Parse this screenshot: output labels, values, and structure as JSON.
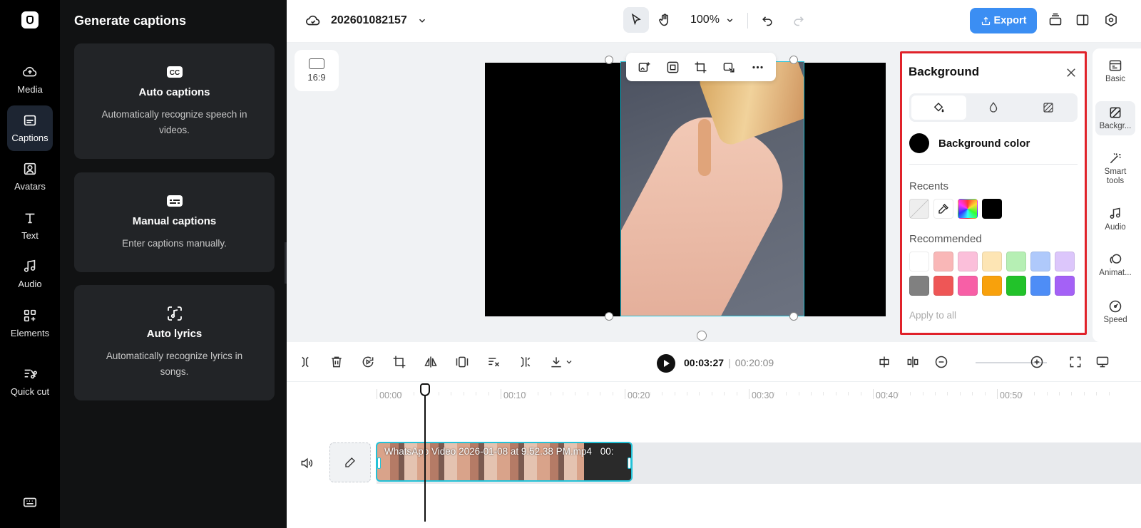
{
  "left_rail": {
    "items": [
      {
        "label": "Media",
        "icon": "cloud-upload-icon"
      },
      {
        "label": "Captions",
        "icon": "captions-icon",
        "active": true
      },
      {
        "label": "Avatars",
        "icon": "avatar-icon"
      },
      {
        "label": "Text",
        "icon": "text-icon"
      },
      {
        "label": "Audio",
        "icon": "music-note-icon"
      },
      {
        "label": "Elements",
        "icon": "elements-icon"
      },
      {
        "label": "Quick cut",
        "icon": "quick-cut-icon"
      }
    ]
  },
  "captions_panel": {
    "title": "Generate captions",
    "cards": [
      {
        "title": "Auto captions",
        "desc": "Automatically recognize speech in videos.",
        "icon": "cc-icon"
      },
      {
        "title": "Manual captions",
        "desc": "Enter captions manually.",
        "icon": "subtitle-icon"
      },
      {
        "title": "Auto lyrics",
        "desc": "Automatically recognize lyrics in songs.",
        "icon": "music-scan-icon"
      }
    ]
  },
  "topbar": {
    "project_name": "202601082157",
    "zoom": "100%",
    "export_label": "Export"
  },
  "canvas": {
    "aspect_ratio": "16:9"
  },
  "background_panel": {
    "title": "Background",
    "bg_color_label": "Background color",
    "bg_color": "#000000",
    "recents_label": "Recents",
    "recommended_label": "Recommended",
    "apply_all": "Apply to all",
    "recents": [
      "none",
      "eyedropper",
      "rainbow",
      "#000000"
    ],
    "recommended_row1": [
      "#ffffff",
      "#f9b7b7",
      "#fbbfda",
      "#fde5b4",
      "#b6efb4",
      "#afc9fb",
      "#dcc6fb"
    ],
    "recommended_row2": [
      "#808080",
      "#ee5656",
      "#f75fa6",
      "#f8a10c",
      "#22c22a",
      "#4e8df6",
      "#a461f6"
    ]
  },
  "right_rail": {
    "items": [
      {
        "label": "Basic",
        "icon": "basic-icon"
      },
      {
        "label": "Backgr...",
        "icon": "background-icon",
        "active": true
      },
      {
        "label": "Smart tools",
        "icon": "magic-wand-icon"
      },
      {
        "label": "Audio",
        "icon": "music-note-icon"
      },
      {
        "label": "Animat...",
        "icon": "animation-icon"
      },
      {
        "label": "Speed",
        "icon": "speed-icon"
      }
    ]
  },
  "playback": {
    "current": "00:03:27",
    "separator": "|",
    "total": "00:20:09"
  },
  "timeline": {
    "ruler": [
      "00:00",
      "00:10",
      "00:20",
      "00:30",
      "00:40",
      "00:50"
    ],
    "clip_label": "WhatsApp Video 2026-01-08 at 9.52.38 PM.mp4",
    "clip_duration": "00:"
  }
}
